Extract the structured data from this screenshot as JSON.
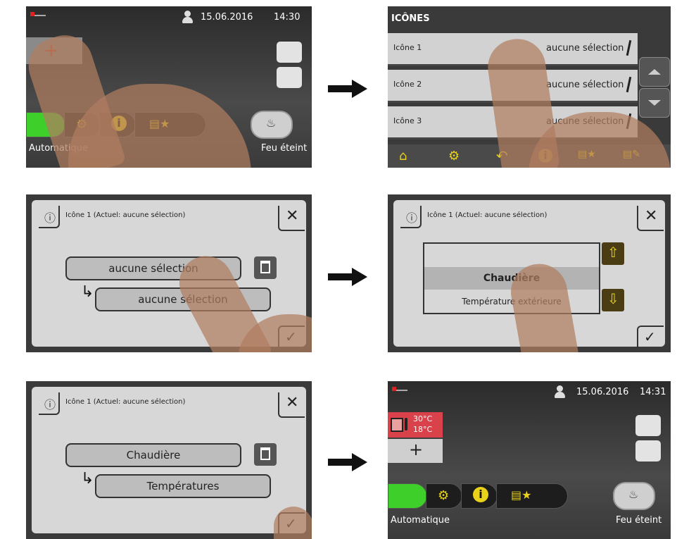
{
  "panel1": {
    "usb_icon": "usb-icon",
    "date": "15.06.2016",
    "time": "14:30",
    "mode_label": "Automatique",
    "fire_label": "Feu éteint"
  },
  "panel2": {
    "title": "ICÔNES",
    "rows": [
      {
        "label": "Icône 1",
        "value": "aucune sélection"
      },
      {
        "label": "Icône 2",
        "value": "aucune sélection"
      },
      {
        "label": "Icône 3",
        "value": "aucune sélection"
      }
    ]
  },
  "panel3": {
    "title": "Icône 1 (Actuel: aucune sélection)",
    "primary": "aucune sélection",
    "secondary": "aucune sélection"
  },
  "panel4": {
    "title": "Icône 1 (Actuel: aucune sélection)",
    "options": [
      "",
      "Chaudière",
      "Température extérieure"
    ]
  },
  "panel5": {
    "title": "Icône 1 (Actuel: aucune sélection)",
    "primary": "Chaudière",
    "secondary": "Températures"
  },
  "panel6": {
    "date": "15.06.2016",
    "time": "14:31",
    "temp1": "30°C",
    "temp2": "18°C",
    "add": "+",
    "mode_label": "Automatique",
    "fire_label": "Feu éteint"
  },
  "colors": {
    "accent_green": "#3ecf2a",
    "icon_yellow": "#e9d21a",
    "tile_red": "#d9424a",
    "bg_dark": "#3a3a3a"
  }
}
